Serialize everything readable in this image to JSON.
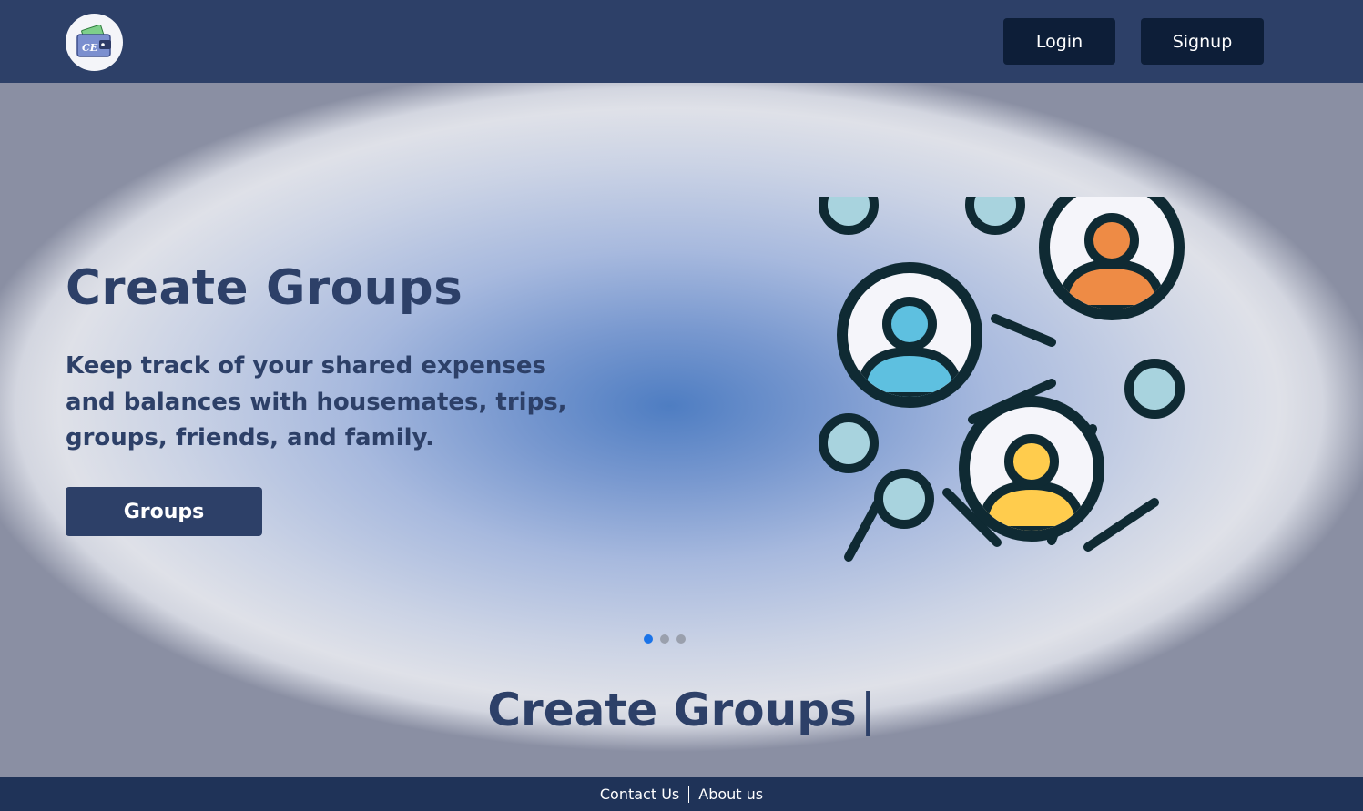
{
  "header": {
    "logo_text": "CE",
    "login_label": "Login",
    "signup_label": "Signup"
  },
  "hero": {
    "title": "Create Groups",
    "description": "Keep track of your shared expenses and balances with housemates, trips, groups, friends, and family.",
    "button_label": "Groups",
    "illustration_icon": "people-network-icon",
    "carousel": {
      "count": 3,
      "active": 0
    },
    "typed_heading": "Create Groups",
    "typed_cursor": "|"
  },
  "footer": {
    "contact_label": "Contact Us",
    "about_label": "About us"
  },
  "colors": {
    "navbar": "#2d4068",
    "button_dark": "#0d1e38",
    "heading": "#2d4068",
    "footer": "#1f3358",
    "person_blue": "#5ec0e0",
    "person_orange": "#ee8b45",
    "person_yellow": "#ffcc4d",
    "node_light": "#a8d3de",
    "outline": "#0f2a33"
  }
}
